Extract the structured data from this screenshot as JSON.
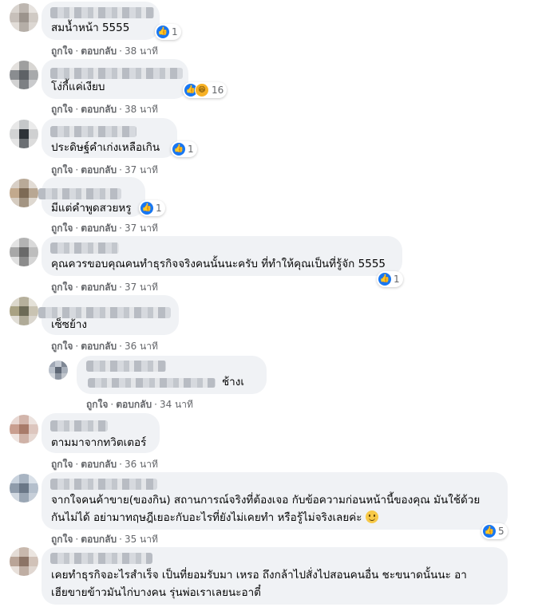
{
  "actions": {
    "like": "ถูกใจ",
    "separator": "·",
    "reply": "ตอบกลับ"
  },
  "comments": [
    {
      "text": "สมน้ำหน้า 5555",
      "time": "38 นาที",
      "reactions": "1"
    },
    {
      "text": "โง่กี้แค่เงียบ",
      "time": "38 นาที",
      "reactions": "16"
    },
    {
      "text": "ประดิษฐ์คำเก่งเหลือเกิน",
      "time": "37 นาที",
      "reactions": "1"
    },
    {
      "text": "มีแต่คำพูดสวยหรู",
      "time": "37 นาที",
      "reactions": "1"
    },
    {
      "text": "คุณควรขอบคุณคนทำธุรกิจจริงคนนั้นนะครับ ที่ทำให้คุณเป็นที่รู้จัก 5555",
      "time": "37 นาที",
      "reactions": "1"
    },
    {
      "text": "เซ็ซย้าง",
      "time": "36 นาที"
    },
    {
      "text": "ช้างเ",
      "time": "34 นาที"
    },
    {
      "text": "ตามมาจากทวิตเตอร์",
      "time": "36 นาที"
    },
    {
      "text_line1": "จากใจคนค้าขาย(ของกิน) สถานการณ์จริงที่ต้องเจอ กับข้อความก่อนหน้านี้ของคุณ มันใช้ด้วย",
      "text_line2": "กันไม่ได้ อย่ามาทฤษฎีเยอะกับอะไรที่ยังไม่เคยทำ หรือรู้ไม่จริงเลยค่ะ",
      "time": "35 นาที",
      "reactions": "5"
    },
    {
      "text_line1": "เคยทำธุรกิจอะไรสำเร็จ เป็นที่ยอมรับมา เหรอ ถึงกล้าไปสั่งไปสอนคนอื่น ชะขนาดนั้นนะ อา",
      "text_line2": "เฮียขายข้าวมันไก่บางคน รุ่นพ่อเราเลยนะอาตี๋"
    }
  ]
}
